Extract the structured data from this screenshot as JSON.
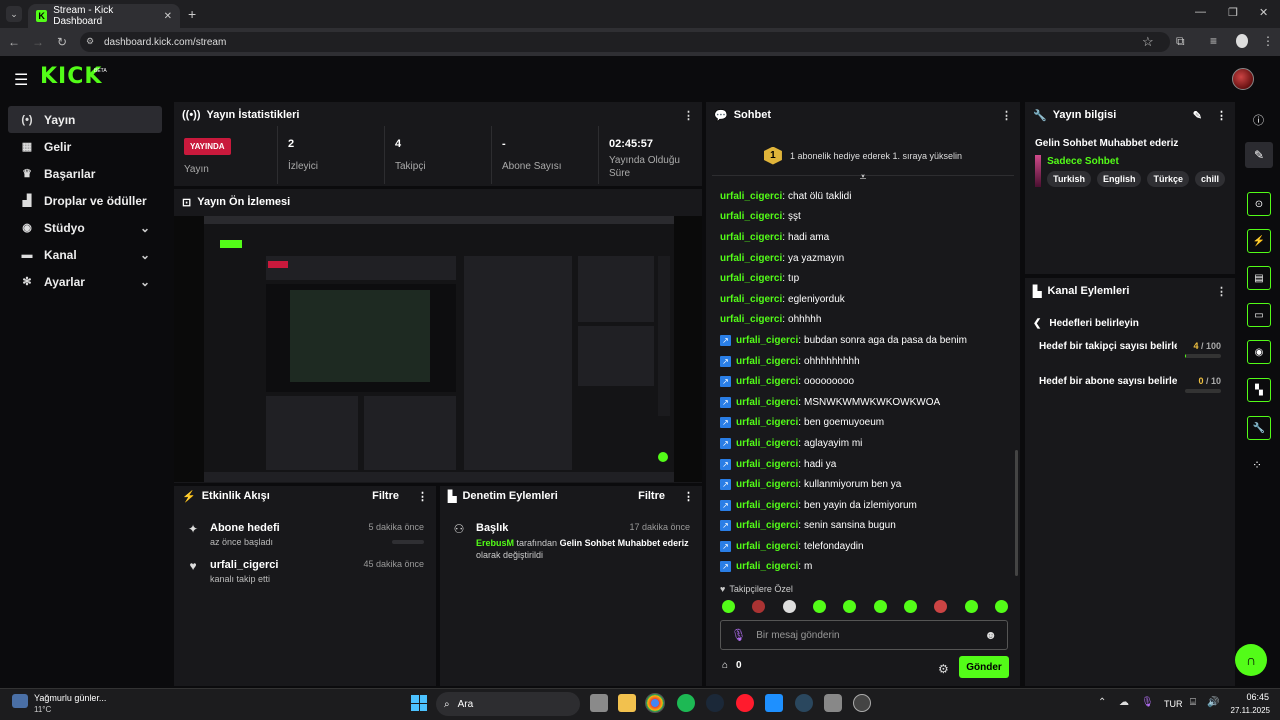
{
  "browser": {
    "tab_title": "Stream - Kick Dashboard",
    "url": "dashboard.kick.com/stream",
    "favicon_letter": "K"
  },
  "brand": {
    "logo": "KICK",
    "beta": "BETA",
    "accent": "#53fc18"
  },
  "sidebar": {
    "items": [
      {
        "label": "Yayın",
        "icon": "broadcast-icon",
        "glyph": "(•)",
        "active": true
      },
      {
        "label": "Gelir",
        "icon": "revenue-icon",
        "glyph": "▦"
      },
      {
        "label": "Başarılar",
        "icon": "trophy-icon",
        "glyph": "♛"
      },
      {
        "label": "Droplar ve ödüller",
        "icon": "drops-icon",
        "glyph": "▟"
      },
      {
        "label": "Stüdyo",
        "icon": "studio-icon",
        "glyph": "◉",
        "chevron": "⌄"
      },
      {
        "label": "Kanal",
        "icon": "channel-icon",
        "glyph": "▬",
        "chevron": "⌄"
      },
      {
        "label": "Ayarlar",
        "icon": "settings-icon",
        "glyph": "✻",
        "chevron": "⌄"
      }
    ]
  },
  "stats": {
    "title": "Yayın İstatistikleri",
    "live_badge": "YAYINDA",
    "live_label": "Yayın",
    "viewers": {
      "value": "2",
      "label": "İzleyici"
    },
    "followers": {
      "value": "4",
      "label": "Takipçi"
    },
    "subs": {
      "value": "-",
      "label": "Abone Sayısı"
    },
    "uptime": {
      "value": "02:45:57",
      "label": "Yayında Olduğu Süre"
    }
  },
  "preview": {
    "title": "Yayın Ön İzlemesi"
  },
  "activity": {
    "title": "Etkinlik Akışı",
    "filter": "Filtre",
    "items": [
      {
        "title": "Abone hedefi",
        "sub": "az önce başladı",
        "when": "5 dakika önce"
      },
      {
        "title": "urfali_cigerci",
        "sub": "kanalı takip etti",
        "when": "45 dakika önce"
      }
    ]
  },
  "moderation": {
    "title": "Denetim Eylemleri",
    "filter": "Filtre",
    "item": {
      "title": "Başlık",
      "when": "17 dakika önce",
      "user": "ErebusM",
      "mid": "tarafından",
      "new_title": "Gelin Sohbet Muhabbet ederiz",
      "tail": "olarak değiştirildi"
    }
  },
  "chat": {
    "title": "Sohbet",
    "gift_rank": "1",
    "gift_text": "1 abonelik hediye ederek 1. sıraya yükselin",
    "messages": [
      {
        "user": "urfali_cigerci",
        "text": "chat ölü taklidi",
        "badge": false
      },
      {
        "user": "urfali_cigerci",
        "text": "şşt",
        "badge": false
      },
      {
        "user": "urfali_cigerci",
        "text": "hadi ama",
        "badge": false
      },
      {
        "user": "urfali_cigerci",
        "text": "ya yazmayın",
        "badge": false
      },
      {
        "user": "urfali_cigerci",
        "text": "tıp",
        "badge": false
      },
      {
        "user": "urfali_cigerci",
        "text": "egleniyorduk",
        "badge": false
      },
      {
        "user": "urfali_cigerci",
        "text": "ohhhhh",
        "badge": false
      },
      {
        "user": "urfali_cigerci",
        "text": "bubdan sonra aga da pasa da benim",
        "badge": true
      },
      {
        "user": "urfali_cigerci",
        "text": "ohhhhhhhhh",
        "badge": true
      },
      {
        "user": "urfali_cigerci",
        "text": "ooooooooo",
        "badge": true
      },
      {
        "user": "urfali_cigerci",
        "text": "MSNWKWMWKWKOWKWOA",
        "badge": true
      },
      {
        "user": "urfali_cigerci",
        "text": "ben goemuyoeum",
        "badge": true
      },
      {
        "user": "urfali_cigerci",
        "text": "aglayayim mi",
        "badge": true
      },
      {
        "user": "urfali_cigerci",
        "text": "hadi ya",
        "badge": true
      },
      {
        "user": "urfali_cigerci",
        "text": "kullanmiyorum ben ya",
        "badge": true
      },
      {
        "user": "urfali_cigerci",
        "text": "ben yayin da izlemiyorum",
        "badge": true
      },
      {
        "user": "urfali_cigerci",
        "text": "senin sansina bugun",
        "badge": true
      },
      {
        "user": "urfali_cigerci",
        "text": "telefondaydin",
        "badge": true
      },
      {
        "user": "urfali_cigerci",
        "text": "m",
        "badge": true
      }
    ],
    "emote_section": "Takipçilere Özel",
    "input_placeholder": "Bir mesaj gönderin",
    "points": "0",
    "send": "Gönder"
  },
  "stream_info": {
    "title": "Yayın bilgisi",
    "stream_title": "Gelin Sohbet Muhabbet ederiz",
    "category": "Sadece Sohbet",
    "tags": [
      "Turkish",
      "English",
      "Türkçe",
      "chill"
    ]
  },
  "channel_actions": {
    "title": "Kanal Eylemleri",
    "back_label": "Hedefleri belirleyin",
    "goals": [
      {
        "label": "Hedef bir takipçi sayısı belirle...",
        "current": "4",
        "target": "100",
        "fraction": 0.04
      },
      {
        "label": "Hedef bir abone sayısı belirleyin",
        "current": "0",
        "target": "10",
        "fraction": 0.0
      }
    ]
  },
  "taskbar": {
    "weather": "Yağmurlu günler...",
    "temp": "11°C",
    "search": "Ara",
    "lang": "TUR",
    "time": "06:45",
    "date": "27.11.2025"
  }
}
